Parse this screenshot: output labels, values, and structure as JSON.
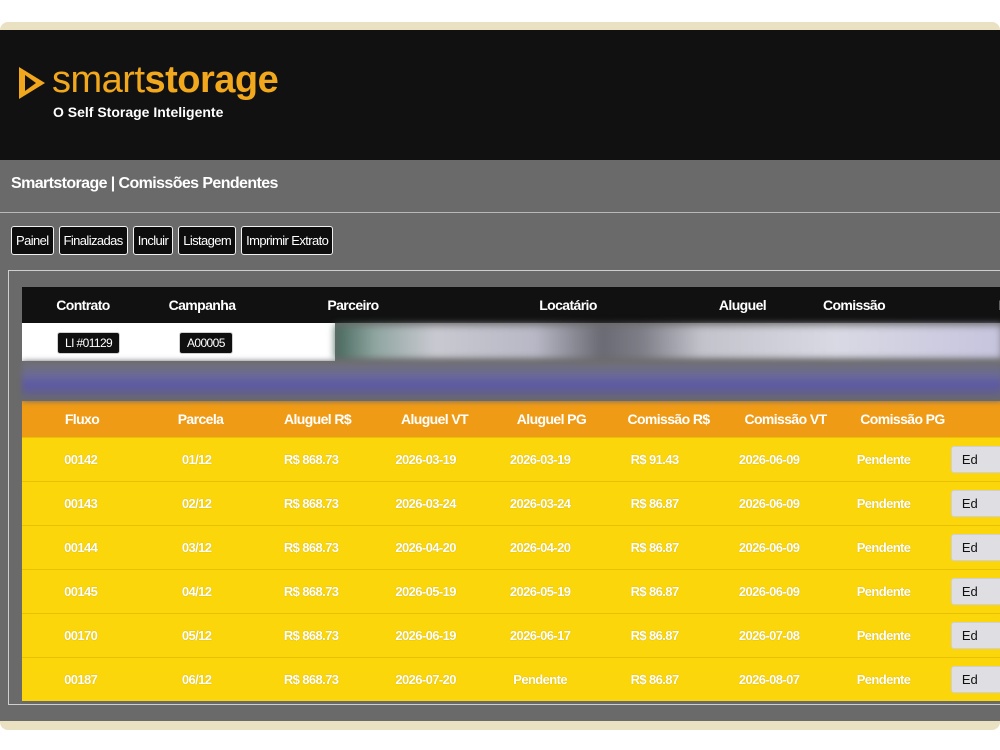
{
  "header": {
    "brand_part1": "smart",
    "brand_part2": "storage",
    "tagline": "O Self Storage Inteligente",
    "logo_icon": "play-triangle-icon",
    "brand_color": "#f2a81d"
  },
  "page": {
    "title": "Smartstorage | Comissões Pendentes"
  },
  "toolbar": {
    "buttons": [
      "Painel",
      "Finalizadas",
      "Incluir",
      "Listagem",
      "Imprimir Extrato"
    ]
  },
  "contract_table": {
    "columns": [
      "Contrato",
      "Campanha",
      "Parceiro",
      "Locatário",
      "Aluguel",
      "Comissão",
      "I"
    ],
    "row": {
      "contrato": "LI #01129",
      "campanha": "A00005"
    }
  },
  "flow_table": {
    "header_color": "#ef9b16",
    "row_color": "#fbd60a",
    "columns": [
      "Fluxo",
      "Parcela",
      "Aluguel R$",
      "Aluguel VT",
      "Aluguel PG",
      "Comissão R$",
      "Comissão VT",
      "Comissão PG",
      ""
    ],
    "rows": [
      {
        "fluxo": "00142",
        "parcela": "01/12",
        "aluguel": "R$ 868.73",
        "aluguel_vt": "2026-03-19",
        "aluguel_pg": "2026-03-19",
        "comissao": "R$ 91.43",
        "comissao_vt": "2026-06-09",
        "comissao_pg": "Pendente",
        "action": "Ed"
      },
      {
        "fluxo": "00143",
        "parcela": "02/12",
        "aluguel": "R$ 868.73",
        "aluguel_vt": "2026-03-24",
        "aluguel_pg": "2026-03-24",
        "comissao": "R$ 86.87",
        "comissao_vt": "2026-06-09",
        "comissao_pg": "Pendente",
        "action": "Ed"
      },
      {
        "fluxo": "00144",
        "parcela": "03/12",
        "aluguel": "R$ 868.73",
        "aluguel_vt": "2026-04-20",
        "aluguel_pg": "2026-04-20",
        "comissao": "R$ 86.87",
        "comissao_vt": "2026-06-09",
        "comissao_pg": "Pendente",
        "action": "Ed"
      },
      {
        "fluxo": "00145",
        "parcela": "04/12",
        "aluguel": "R$ 868.73",
        "aluguel_vt": "2026-05-19",
        "aluguel_pg": "2026-05-19",
        "comissao": "R$ 86.87",
        "comissao_vt": "2026-06-09",
        "comissao_pg": "Pendente",
        "action": "Ed"
      },
      {
        "fluxo": "00170",
        "parcela": "05/12",
        "aluguel": "R$ 868.73",
        "aluguel_vt": "2026-06-19",
        "aluguel_pg": "2026-06-17",
        "comissao": "R$ 86.87",
        "comissao_vt": "2026-07-08",
        "comissao_pg": "Pendente",
        "action": "Ed"
      },
      {
        "fluxo": "00187",
        "parcela": "06/12",
        "aluguel": "R$ 868.73",
        "aluguel_vt": "2026-07-20",
        "aluguel_pg": "Pendente",
        "comissao": "R$ 86.87",
        "comissao_vt": "2026-08-07",
        "comissao_pg": "Pendente",
        "action": "Ed"
      }
    ]
  }
}
